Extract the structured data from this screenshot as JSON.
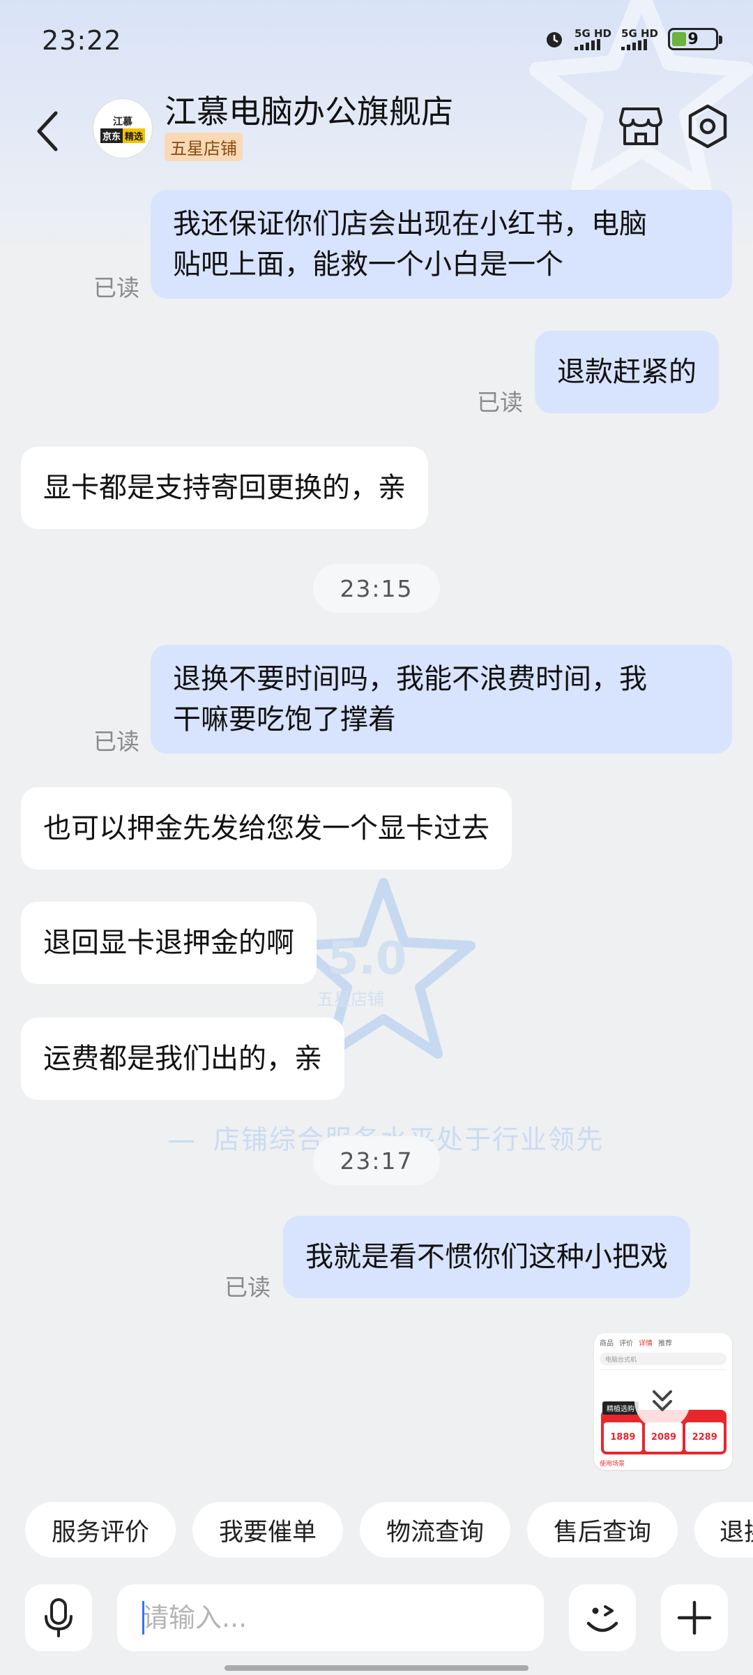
{
  "status_bar": {
    "time": "23:22",
    "network1": "5G HD",
    "network2": "5G HD",
    "battery": "9"
  },
  "header": {
    "shop_name": "江慕电脑办公旗舰店",
    "shop_badge": "五星店铺",
    "avatar_top": "江慕",
    "avatar_left": "京东",
    "avatar_right": "精选",
    "store_icon": "store-icon",
    "settings_icon": "hexagon-settings-icon"
  },
  "messages": [
    {
      "side": "out",
      "lines": [
        "我还保证你们店会出现在小红书，电脑",
        "贴吧上面，能救一个小白是一个"
      ],
      "status": "已读"
    },
    {
      "side": "out",
      "lines": [
        "退款赶紧的"
      ],
      "status": "已读"
    },
    {
      "side": "in",
      "lines": [
        "显卡都是支持寄回更换的，亲"
      ]
    },
    {
      "time": "23:15"
    },
    {
      "side": "out",
      "lines": [
        "退换不要时间吗，我能不浪费时间，我",
        "干嘛要吃饱了撑着"
      ],
      "status": "已读"
    },
    {
      "side": "in",
      "lines": [
        "也可以押金先发给您发一个显卡过去"
      ]
    },
    {
      "side": "in",
      "lines": [
        "退回显卡退押金的啊"
      ]
    },
    {
      "side": "in",
      "lines": [
        "运费都是我们出的，亲"
      ]
    },
    {
      "time": "23:17"
    },
    {
      "side": "out",
      "lines": [
        "我就是看不惯你们这种小把戏"
      ],
      "status": "已读"
    }
  ],
  "watermark": {
    "score": "5.0",
    "label": "五星店铺",
    "text": "店铺综合服务水平处于行业领先"
  },
  "product_card": {
    "tabs": [
      "商品",
      "评价",
      "详情",
      "推荐"
    ],
    "search": "电脑台式机",
    "tag": "精植选购",
    "prices": [
      "1889",
      "2089",
      "2289"
    ],
    "bottom": "使用场景"
  },
  "quick_replies": [
    "服务评价",
    "我要催单",
    "物流查询",
    "售后查询",
    "退换"
  ],
  "input": {
    "placeholder": "请输入..."
  },
  "colors": {
    "outgoing_bubble": "#d8e3fd",
    "incoming_bubble": "#ffffff",
    "background": "#eef0f2",
    "badge_bg": "#fbd9b7"
  }
}
